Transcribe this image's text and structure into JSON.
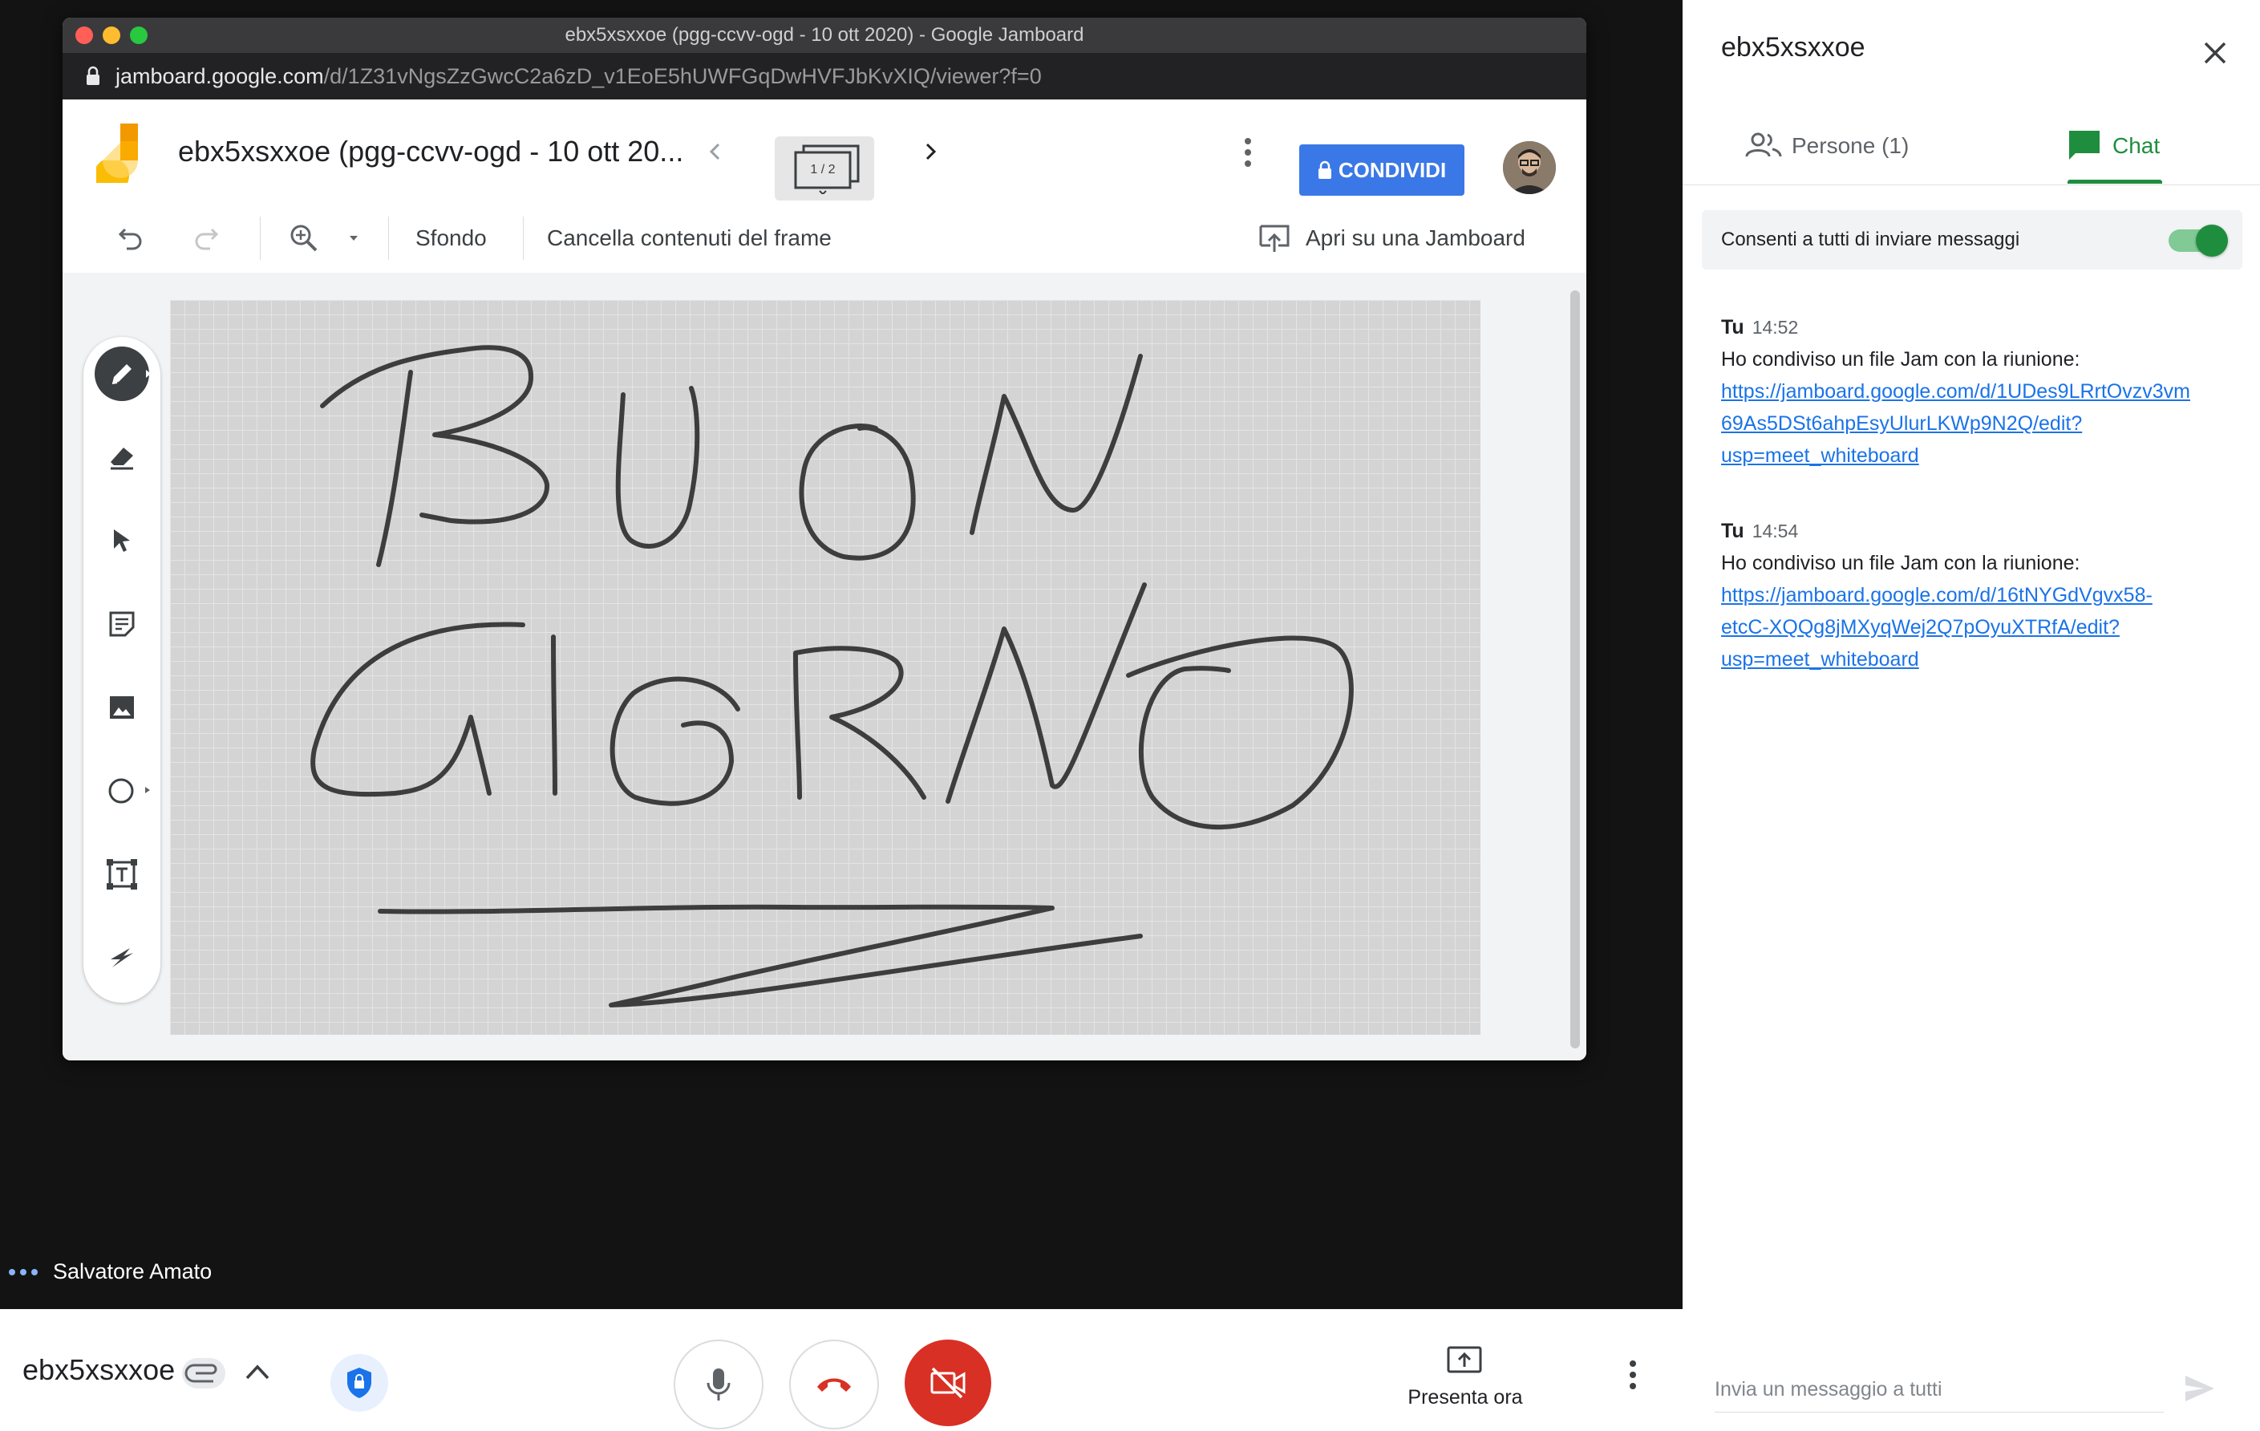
{
  "window": {
    "title": "ebx5xsxxoe (pgg-ccvv-ogd - 10 ott 2020) - Google Jamboard",
    "url_host": "jamboard.google.com",
    "url_path": "/d/1Z31vNgsZzGwcC2a6zD_v1EoE5hUWFGqDwHVFJbKvXIQ/viewer?f=0"
  },
  "jamboard": {
    "title": "ebx5xsxxoe (pgg-ccvv-ogd - 10 ott 20...",
    "frame_indicator": "1 / 2",
    "share_label": "CONDIVIDI",
    "toolbar": {
      "background_label": "Sfondo",
      "clear_frame_label": "Cancella contenuti del frame",
      "open_label": "Apri su una Jamboard"
    },
    "tools": [
      "pen-tool",
      "eraser-tool",
      "select-tool",
      "sticky-note-tool",
      "image-tool",
      "circle-tool",
      "text-box-tool",
      "laser-tool"
    ],
    "colors": {
      "share": "#3b78e7",
      "board": "#d4d4d4"
    }
  },
  "meet": {
    "participant_name": "Salvatore Amato",
    "meeting_name": "ebx5xsxxoe",
    "present_label": "Presenta ora",
    "colors": {
      "end_call": "#d93025",
      "camera_off": "#d93025"
    }
  },
  "panel": {
    "title": "ebx5xsxxoe",
    "tab_people": "Persone (1)",
    "tab_chat": "Chat",
    "allow_messages": "Consenti a tutti di inviare messaggi",
    "allow_messages_on": true,
    "messages": [
      {
        "sender": "Tu",
        "time": "14:52",
        "text": "Ho condiviso un file Jam con la riunione:",
        "link_lines": [
          "https://jamboard.google.com/d/1UDes9LRrtOvzv3vm",
          "69As5DSt6ahpEsyUlurLKWp9N2Q/edit?",
          "usp=meet_whiteboard"
        ]
      },
      {
        "sender": "Tu",
        "time": "14:54",
        "text": "Ho condiviso un file Jam con la riunione:",
        "link_lines": [
          "https://jamboard.google.com/d/16tNYGdVgvx58-",
          "etcC-XQQg8jMXyqWej2Q7pOyuXTRfA/edit?",
          "usp=meet_whiteboard"
        ]
      }
    ],
    "input_placeholder": "Invia un messaggio a tutti",
    "colors": {
      "accent": "#1e8e3e",
      "link": "#1a73e8"
    }
  }
}
